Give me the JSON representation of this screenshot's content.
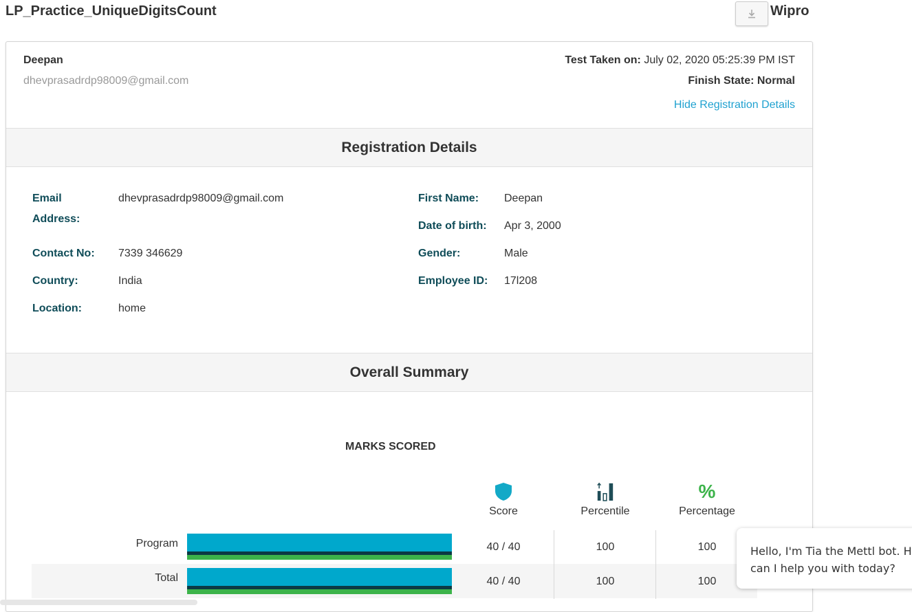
{
  "header": {
    "title": "LP_Practice_UniqueDigitsCount",
    "download_icon": "download-icon",
    "org": "Wipro"
  },
  "candidate": {
    "name": "Deepan",
    "email": "dhevprasadrdp98009@gmail.com",
    "test_taken_label": "Test Taken on:",
    "test_taken_value": "July 02, 2020 05:25:39 PM IST",
    "finish_state_label": "Finish State:",
    "finish_state_value": "Normal",
    "hide_link": "Hide Registration Details"
  },
  "registration": {
    "title": "Registration Details",
    "left": [
      {
        "label_line1": "Email",
        "label_line2": "Address:",
        "value": "dhevprasadrdp98009@gmail.com"
      },
      {
        "label": "Contact No:",
        "value": "7339 346629"
      },
      {
        "label": "Country:",
        "value": "India"
      },
      {
        "label": "Location:",
        "value": "home"
      }
    ],
    "right": [
      {
        "label": "First Name:",
        "value": "Deepan"
      },
      {
        "label": "Date of birth:",
        "value": "Apr 3, 2000"
      },
      {
        "label": "Gender:",
        "value": "Male"
      },
      {
        "label": "Employee ID:",
        "value": "17l208"
      }
    ]
  },
  "summary": {
    "title": "Overall Summary",
    "marks_title": "MARKS SCORED",
    "columns": [
      {
        "label": "Score",
        "icon": "shield-icon"
      },
      {
        "label": "Percentile",
        "icon": "bar-chart-icon"
      },
      {
        "label": "Percentage",
        "icon": "percent-icon"
      }
    ],
    "rows": [
      {
        "label": "Program",
        "score": "40 / 40",
        "percentile": "100",
        "percentage": "100",
        "fill": 1.0
      },
      {
        "label": "Total",
        "score": "40 / 40",
        "percentile": "100",
        "percentage": "100",
        "fill": 1.0
      }
    ],
    "colors": {
      "bar": "#00a8cc",
      "bar_dark": "#0b3a44",
      "bar_green": "#3cb34a",
      "label": "#0f4c58",
      "link": "#1fa1d0"
    }
  },
  "chat": {
    "line1": "Hello, I'm Tia the Mettl bot. How",
    "line2": "can I help you with today?"
  }
}
